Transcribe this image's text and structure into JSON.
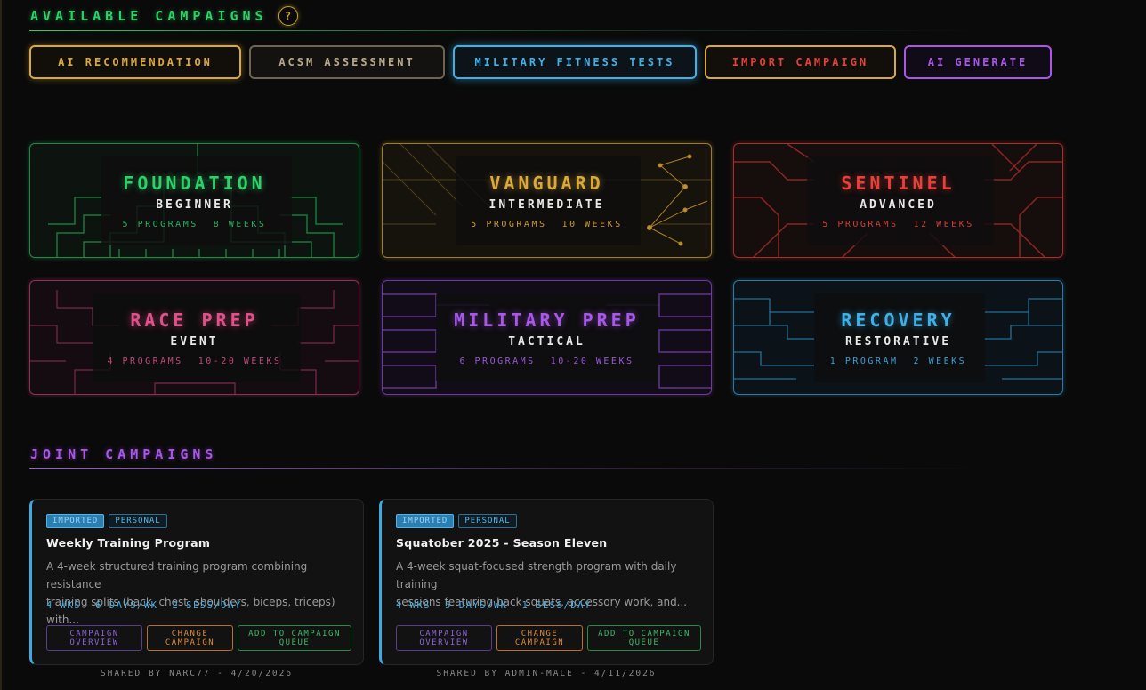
{
  "sections": {
    "available": "AVAILABLE CAMPAIGNS",
    "joint": "JOINT CAMPAIGNS",
    "help": "?"
  },
  "colors": {
    "green": "#2fd06a",
    "gold": "#d9a93a",
    "red": "#e5403a",
    "pink": "#e0508a",
    "purple": "#a857e8",
    "cyan": "#3fb0e8",
    "orange": "#e08b35"
  },
  "buttons": [
    {
      "label": "AI RECOMMENDATION",
      "color": "#d9a93a"
    },
    {
      "label": "ACSM ASSESSMENT",
      "color": "#b8a98a"
    },
    {
      "label": "MILITARY FITNESS TESTS",
      "color": "#3fb0e8"
    },
    {
      "label": "IMPORT CAMPAIGN",
      "color": "#e5403a"
    },
    {
      "label": "AI GENERATE",
      "color": "#a857e8"
    }
  ],
  "campaigns": [
    {
      "name": "FOUNDATION",
      "level": "BEGINNER",
      "programs": "5 PROGRAMS",
      "duration": "8 WEEKS",
      "color": "#2fd06a"
    },
    {
      "name": "VANGUARD",
      "level": "INTERMEDIATE",
      "programs": "5 PROGRAMS",
      "duration": "10 WEEKS",
      "color": "#d9a93a"
    },
    {
      "name": "SENTINEL",
      "level": "ADVANCED",
      "programs": "5 PROGRAMS",
      "duration": "12 WEEKS",
      "color": "#e5403a"
    },
    {
      "name": "RACE PREP",
      "level": "EVENT",
      "programs": "4 PROGRAMS",
      "duration": "10-20 WEEKS",
      "color": "#e0508a"
    },
    {
      "name": "MILITARY PREP",
      "level": "TACTICAL",
      "programs": "6 PROGRAMS",
      "duration": "10-20 WEEKS",
      "color": "#a857e8"
    },
    {
      "name": "RECOVERY",
      "level": "RESTORATIVE",
      "programs": "1 PROGRAM",
      "duration": "2 WEEKS",
      "color": "#3fb0e8"
    }
  ],
  "joint": [
    {
      "badges": [
        "IMPORTED",
        "PERSONAL"
      ],
      "title": "Weekly Training Program",
      "desc1": "A 4-week structured training program combining resistance",
      "desc2": "training splits (back, chest, shoulders, biceps, triceps) with...",
      "stats": [
        "4 WKS",
        "6 DAYS/WK",
        "2 SESS/DAY"
      ],
      "btn_overview": "CAMPAIGN OVERVIEW",
      "btn_change": "CHANGE CAMPAIGN",
      "btn_queue": "ADD TO CAMPAIGN QUEUE",
      "shared": "SHARED BY NARC77 - 4/20/2026"
    },
    {
      "badges": [
        "IMPORTED",
        "PERSONAL"
      ],
      "title": "Squatober 2025 - Season Eleven",
      "desc1": "A 4-week squat-focused strength program with daily training",
      "desc2": "sessions featuring back squats, accessory work, and...",
      "stats": [
        "4 WKS",
        "5 DAYS/WK",
        "1 SESS/DAY"
      ],
      "btn_overview": "CAMPAIGN OVERVIEW",
      "btn_change": "CHANGE CAMPAIGN",
      "btn_queue": "ADD TO CAMPAIGN QUEUE",
      "shared": "SHARED BY ADMIN-MALE - 4/11/2026"
    }
  ]
}
